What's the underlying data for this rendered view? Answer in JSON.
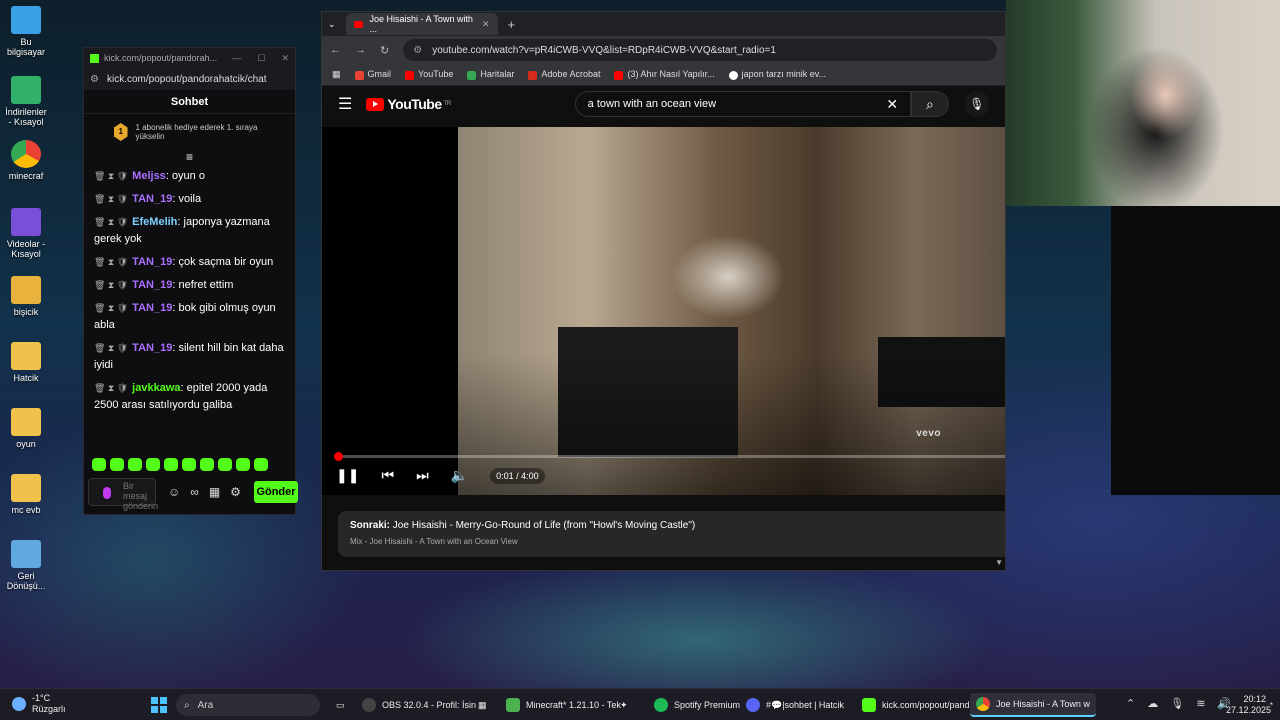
{
  "desktop_icons": [
    {
      "label": "Bu bilgisayar",
      "color": "#3aa0e8"
    },
    {
      "label": "İndirilenler - Kısayol",
      "color": "#31b06a"
    },
    {
      "label": "minecraf",
      "color": "#e8453c"
    },
    {
      "label": "Videolar - Kısayol",
      "color": "#7a4fd8"
    },
    {
      "label": "bişicik",
      "color": "#e8b23c"
    },
    {
      "label": "Hatcik",
      "color": "#f0c24b"
    },
    {
      "label": "oyun",
      "color": "#f0c24b"
    },
    {
      "label": "mc evb",
      "color": "#f0c24b"
    },
    {
      "label": "Geri Dönüşü...",
      "color": "#5fa8e0"
    }
  ],
  "kick": {
    "window_title": "kick.com/popout/pandorah...",
    "address": "kick.com/popout/pandorahatcik/chat",
    "header": "Sohbet",
    "promo_text": "1 abonelik hediye ederek 1. sıraya yükselin",
    "promo_badge": "1",
    "messages": [
      {
        "user": "Meljss",
        "text": "oyun o",
        "style": "purple"
      },
      {
        "user": "TAN_19",
        "text": "voila",
        "style": "purple"
      },
      {
        "user": "EfeMelih",
        "text": "japonya yazmana gerek yok",
        "style": "blue"
      },
      {
        "user": "TAN_19",
        "text": "çok saçma bir oyun",
        "style": "purple"
      },
      {
        "user": "TAN_19",
        "text": "nefret ettim",
        "style": "purple"
      },
      {
        "user": "TAN_19",
        "text": "bok gibi olmuş oyun abla",
        "style": "purple"
      },
      {
        "user": "TAN_19",
        "text": "silent hill bin kat daha iyidi",
        "style": "purple"
      },
      {
        "user": "javkkawa",
        "text": "epitel 2000 yada 2500 arası satılıyordu galiba",
        "style": "green"
      }
    ],
    "input_placeholder": "Bir mesaj gönderin",
    "send_label": "Gönder"
  },
  "browser": {
    "tab_title": "Joe Hisaishi - A Town with ...",
    "url": "youtube.com/watch?v=pR4iCWB-VVQ&list=RDpR4iCWB-VVQ&start_radio=1",
    "bookmarks": [
      {
        "label": "Gmail",
        "color": "#ea4335"
      },
      {
        "label": "YouTube",
        "color": "#ff0000"
      },
      {
        "label": "Haritalar",
        "color": "#34a853"
      },
      {
        "label": "Adobe Acrobat",
        "color": "#d62b1f"
      },
      {
        "label": "(3) Ahır Nasıl Yapılır...",
        "color": "#ff0000"
      },
      {
        "label": "japon tarzı minik ev...",
        "color": "#ffffff"
      }
    ]
  },
  "youtube": {
    "logo": "YouTube",
    "region": "TR",
    "search_query": "a town with an ocean view",
    "time": "0:01 / 4:00",
    "progress_fraction": 0.004,
    "watermark": "vevo",
    "next_label": "Sonraki:",
    "next_title": "Joe Hisaishi - Merry-Go-Round of Life (from \"Howl's Moving Castle\")",
    "next_mix": "Mix - Joe Hisaishi - A Town with an Ocean View"
  },
  "taskbar": {
    "weather_temp": "-1°C",
    "weather_desc": "Rüzgarlı",
    "search_label": "Ara",
    "apps": [
      {
        "label": "OBS 32.0.4 - Profil: İsin",
        "color": "#444"
      },
      {
        "label": "Minecraft* 1.21.10 - Tek",
        "color": "#4caf50"
      },
      {
        "label": "Spotify Premium",
        "color": "#1db954"
      },
      {
        "label": "#💬|sohbet | Hatcik",
        "color": "#5865f2"
      },
      {
        "label": "kick.com/popout/pand",
        "color": "#53fc18"
      },
      {
        "label": "Joe Hisaishi - A Town w",
        "color": "#4285f4"
      }
    ],
    "time": "20:12",
    "date": "27.12.2025"
  }
}
